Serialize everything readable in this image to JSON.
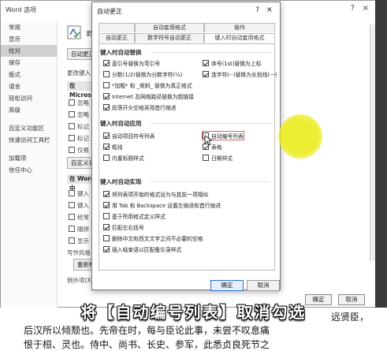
{
  "opts_window": {
    "title": "Word 选项",
    "help": "?",
    "close": "×",
    "sidebar": [
      "常规",
      "显示",
      "校对",
      "保存",
      "版式",
      "语言",
      "轻松访问",
      "高级",
      "自定义功能区",
      "快速访问工具栏",
      "加载项",
      "信任中心"
    ],
    "sidebar_selected": 2,
    "main_texts": {
      "partial_1": "更",
      "partial_2": "自动更正",
      "partial_3": "更改键入",
      "sec_ms": "在 Micros",
      "ms_items": [
        "忽略",
        "忽略",
        "标记",
        "标记",
        "仅根"
      ],
      "custom_dict": "自定义词",
      "sec_word": "在 Word 中",
      "word_items": [
        "键入",
        "键入",
        "经常",
        "随拼",
        "显示"
      ],
      "writing_style": "写作风格",
      "recheck": "重新检",
      "exceptions": "例外项(X)"
    },
    "ok": "确定",
    "cancel": "取消"
  },
  "dialog": {
    "title": "自动更正",
    "help": "?",
    "close": "×",
    "tabs_row1": [
      "自动图文集",
      "自动套用格式",
      "操作"
    ],
    "tabs_row2": [
      "自动更正",
      "数学符号自动更正",
      "键入时自动套用格式"
    ],
    "active_tab": "键入时自动套用格式",
    "section1": "键入时自动替换",
    "s1_left": [
      {
        "label": "直引号替换为弯引号",
        "checked": true
      },
      {
        "label": "分数(1/2)替换为分数字符(½)",
        "checked": false
      },
      {
        "label": "*加粗* 和 _倾斜_ 替换为真正格式",
        "checked": false
      },
      {
        "label": "Internet 及网络路径替换为超链接",
        "checked": true
      },
      {
        "label": "段落开头空格采用首行缩进",
        "checked": true
      }
    ],
    "s1_right": [
      {
        "label": "序号(1st)替换为上标",
        "checked": true
      },
      {
        "label": "连字符(--)替换为长划线(—)",
        "checked": true
      }
    ],
    "section2": "键入时自动应用",
    "s2_left": [
      {
        "label": "自动项目符号列表",
        "checked": true
      },
      {
        "label": "框线",
        "checked": true
      },
      {
        "label": "内置标题样式",
        "checked": false
      }
    ],
    "s2_right": [
      {
        "label": "自动编号列表",
        "checked": false
      },
      {
        "label": "表格",
        "checked": true
      },
      {
        "label": "日期样式",
        "checked": false
      }
    ],
    "section3": "键入时自动实现",
    "s3": [
      {
        "label": "将列表项开始的格式设为与其前一项相似",
        "checked": true
      },
      {
        "label": "用 Tab 和 Backspace 设置左缩进和首行缩进",
        "checked": true
      },
      {
        "label": "基于所用格式定义样式",
        "checked": false
      },
      {
        "label": "匹配左右括号",
        "checked": true
      },
      {
        "label": "删除中文和西文文字之间不必要的空格",
        "checked": false
      },
      {
        "label": "插入结束语以匹配备忘录样式",
        "checked": true
      }
    ],
    "ok": "确定",
    "cancel": "取消"
  },
  "subtitle": "将【自动编号列表】取消勾选",
  "doc_lines": {
    "line1_right": "远贤臣，",
    "line2": "后汉所以倾颓也。先帝在时，每与臣论此事，未尝不叹息痛",
    "line3": "恨于桓、灵也。侍中、尚书、长史、参军，此悉贞良死节之"
  }
}
